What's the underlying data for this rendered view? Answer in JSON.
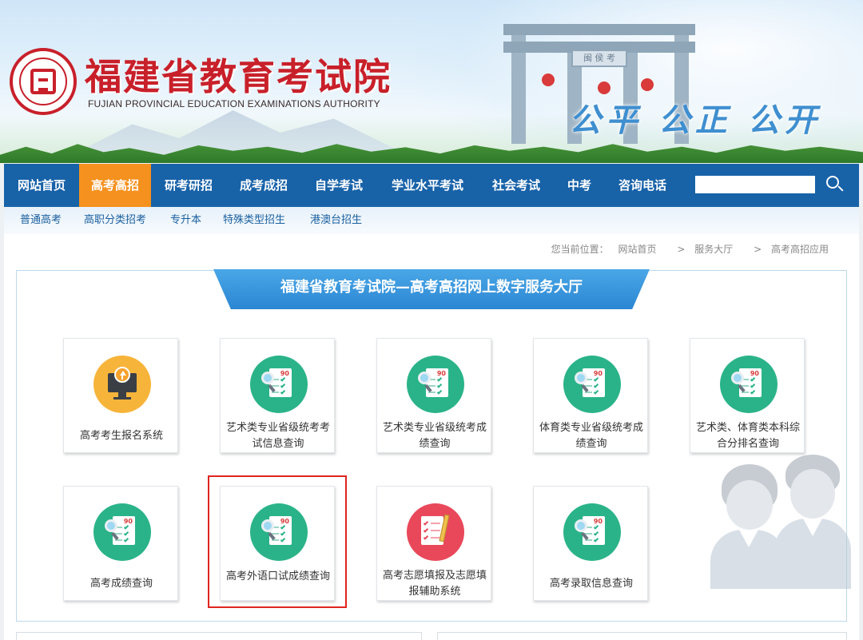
{
  "header": {
    "site_title": "福建省教育考试院",
    "site_subtitle": "FUJIAN PROVINCIAL EDUCATION EXAMINATIONS AUTHORITY",
    "slogan": "公平 公正 公开",
    "plaque_text": "闽 侯 考"
  },
  "nav": {
    "items": [
      {
        "label": "网站首页",
        "active": false
      },
      {
        "label": "高考高招",
        "active": true
      },
      {
        "label": "研考研招",
        "active": false
      },
      {
        "label": "成考成招",
        "active": false
      },
      {
        "label": "自学考试",
        "active": false
      },
      {
        "label": "学业水平考试",
        "active": false
      },
      {
        "label": "社会考试",
        "active": false
      },
      {
        "label": "中考",
        "active": false
      },
      {
        "label": "咨询电话",
        "active": false
      }
    ],
    "search_value": "",
    "search_icon": "search-icon"
  },
  "subnav": {
    "items": [
      "普通高考",
      "高职分类招考",
      "专升本",
      "特殊类型招生",
      "港澳台招生"
    ]
  },
  "breadcrumb": {
    "prefix": "您当前位置：",
    "home": "网站首页",
    "level1": "服务大厅",
    "level2": "高考高招应用",
    "separator": ">"
  },
  "hall": {
    "title": "福建省教育考试院—高考高招网上数字服务大厅",
    "cards": [
      {
        "label": "高考考生报名系统",
        "icon": "monitor-upload-icon",
        "color": "#f7b43a"
      },
      {
        "label": "艺术类专业省级统考考试信息查询",
        "icon": "score-search-icon",
        "color": "#2ab389"
      },
      {
        "label": "艺术类专业省级统考成绩查询",
        "icon": "score-search-icon",
        "color": "#2ab389"
      },
      {
        "label": "体育类专业省级统考成绩查询",
        "icon": "score-search-icon",
        "color": "#2ab389"
      },
      {
        "label": "艺术类、体育类本科综合分排名查询",
        "icon": "score-search-icon",
        "color": "#2ab389"
      },
      {
        "label": "高考成绩查询",
        "icon": "score-search-icon",
        "color": "#2ab389"
      },
      {
        "label": "高考外语口试成绩查询",
        "icon": "score-search-icon",
        "color": "#2ab389"
      },
      {
        "label": "高考志愿填报及志愿填报辅助系统",
        "icon": "checklist-pencil-icon",
        "color": "#e9485a"
      },
      {
        "label": "高考录取信息查询",
        "icon": "score-search-icon",
        "color": "#2ab389"
      }
    ]
  },
  "colors": {
    "nav_bg": "#1862a8",
    "nav_active": "#f5911f",
    "title_red": "#c8202a",
    "highlight": "#e0251f"
  }
}
